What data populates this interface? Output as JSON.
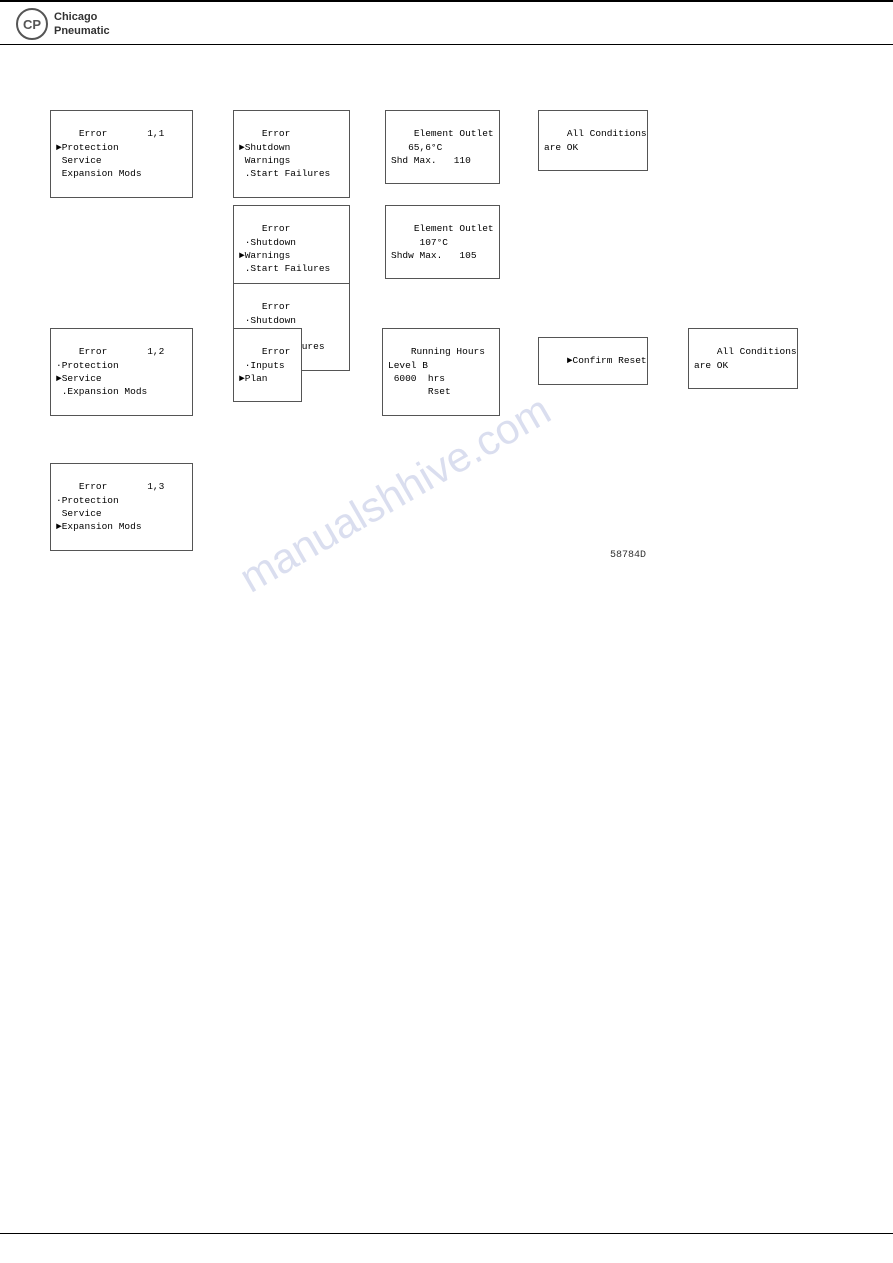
{
  "header": {
    "logo_initials": "CP",
    "logo_line1": "Chicago",
    "logo_line2": "Pneumatic"
  },
  "watermark": "manualshhive.com",
  "figure_label": "58784D",
  "boxes": {
    "box1_1": {
      "id": "box1_1",
      "label": "Error       1,1\n►Protection\n Service\n Expansion Mods"
    },
    "box1_2": {
      "id": "box1_2",
      "label": "Error       1,2\n·Protection\n►Service\n .Expansion Mods"
    },
    "box1_3": {
      "id": "box1_3",
      "label": "Error       1,3\n·Protection\n Service\n►Expansion Mods"
    },
    "box_error_shutdown_warn": {
      "id": "box_error_shutdown_warn",
      "label": "Error\n►Shutdown\n Warnings\n .Start Failures"
    },
    "box_error_shutdown_warn2": {
      "id": "box_error_shutdown_warn2",
      "label": "Error\n ·Shutdown\n►Warnings\n .Start Failures"
    },
    "box_error_shutdown_warn3": {
      "id": "box_error_shutdown_warn3",
      "label": "Error\n ·Shutdown\n Warnings\n►Start Failures"
    },
    "box_element_outlet1": {
      "id": "box_element_outlet1",
      "label": "Element Outlet\n   65,6°C\nShd Max.   110"
    },
    "box_element_outlet2": {
      "id": "box_element_outlet2",
      "label": "Element Outlet\n     107°C\nShdw Max.   105"
    },
    "box_all_ok1": {
      "id": "box_all_ok1",
      "label": "All Conditions\nare OK"
    },
    "box_error_inputs": {
      "id": "box_error_inputs",
      "label": "Error\n ·Inputs\n►Plan"
    },
    "box_running_hours": {
      "id": "box_running_hours",
      "label": "Running Hours\nLevel B\n 6000  hrs\n       Rset"
    },
    "box_confirm_reset": {
      "id": "box_confirm_reset",
      "label": "►Confirm Reset"
    },
    "box_all_ok2": {
      "id": "box_all_ok2",
      "label": "All Conditions\nare OK"
    }
  }
}
